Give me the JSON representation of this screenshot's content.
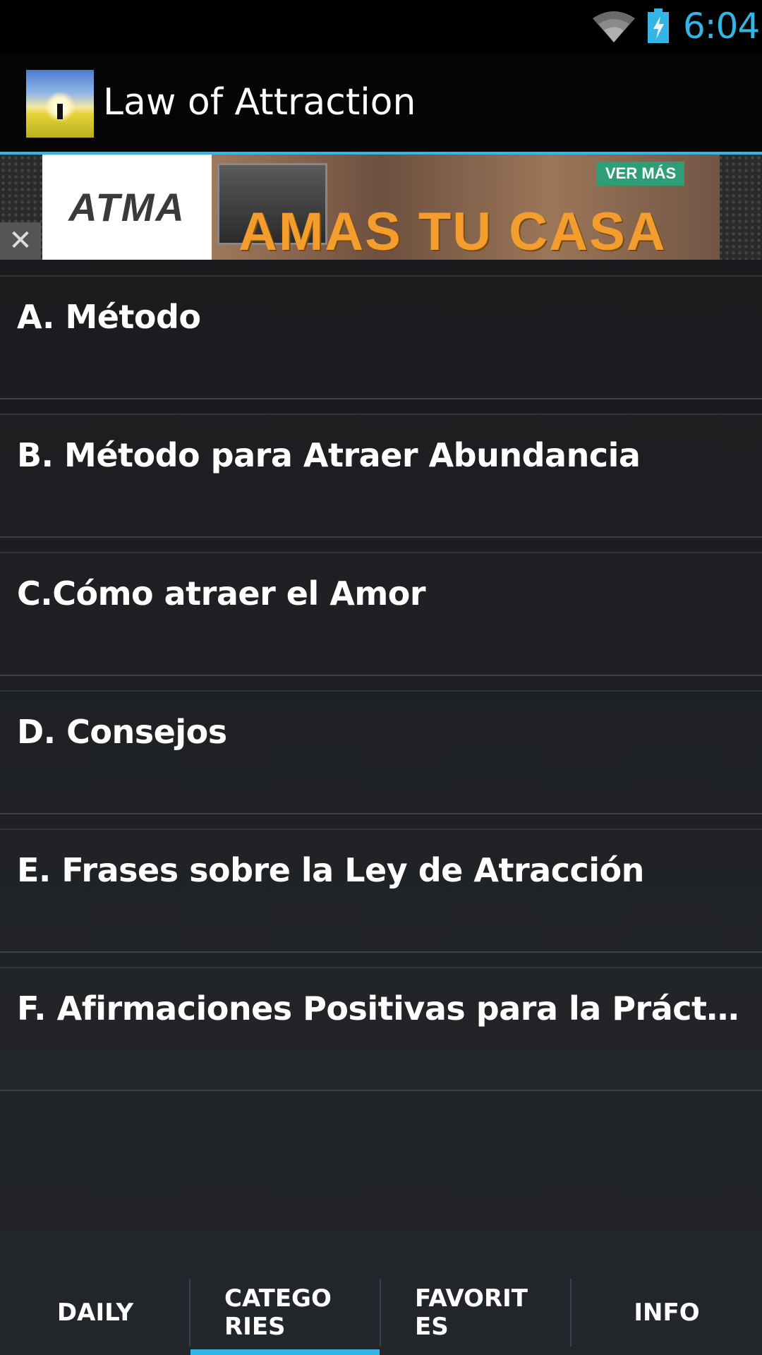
{
  "status_bar": {
    "time": "6:04",
    "icons": [
      "wifi-icon",
      "battery-charging-icon"
    ],
    "accent_color": "#33b5e5"
  },
  "action_bar": {
    "title": "Law of Attraction",
    "icon": "app-logo-icon"
  },
  "ad": {
    "brand": "ATMA",
    "headline": "AMAS TU CASA",
    "cta": "VER MÁS",
    "close_symbol": "✕"
  },
  "categories": [
    {
      "label": "A. Método"
    },
    {
      "label": "B. Método para Atraer Abundancia"
    },
    {
      "label": "C.Cómo atraer el Amor"
    },
    {
      "label": "D. Consejos"
    },
    {
      "label": "E. Frases sobre la Ley de Atracción"
    },
    {
      "label": "F. Afirmaciones Positivas para la Práctica Diaria"
    }
  ],
  "tabs": [
    {
      "label": "DAILY",
      "selected": false
    },
    {
      "label": "CATEGORIES",
      "selected": true
    },
    {
      "label": "FAVORITES",
      "selected": false
    },
    {
      "label": "INFO",
      "selected": false
    }
  ]
}
